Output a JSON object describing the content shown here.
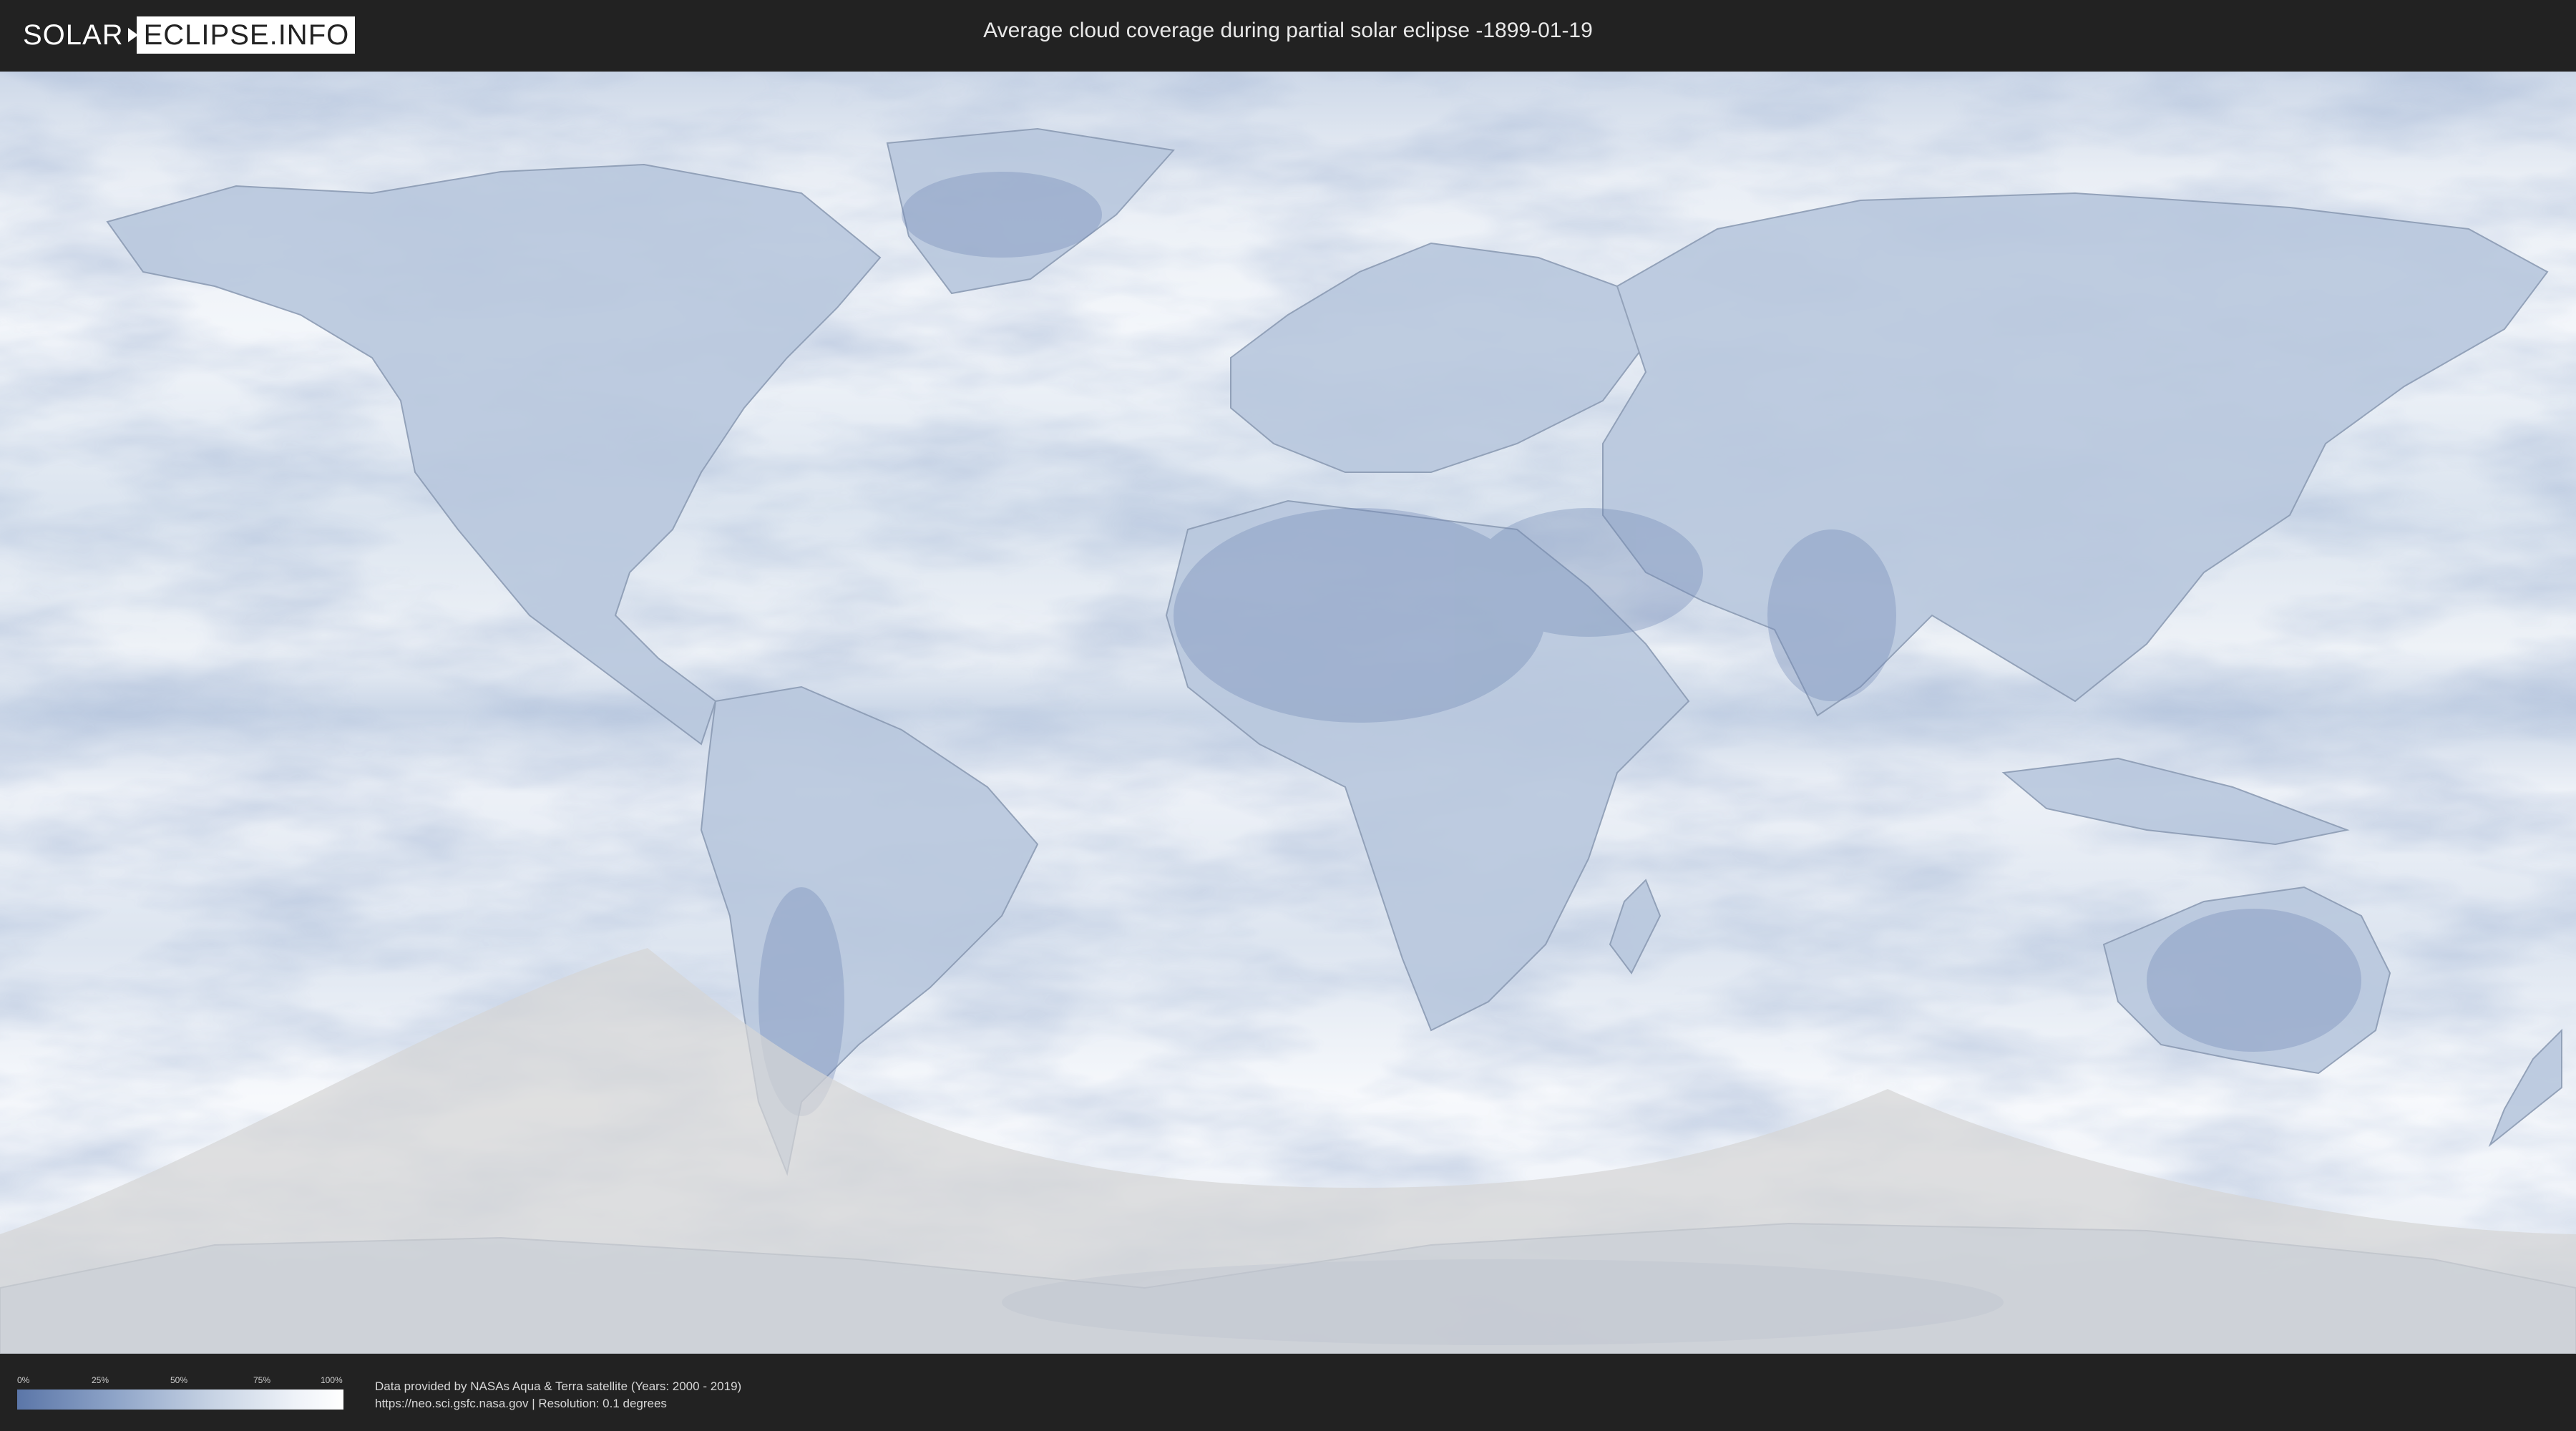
{
  "header": {
    "logo_left": "SOLAR",
    "logo_right": "ECLIPSE.INFO",
    "title": "Average cloud coverage during partial solar eclipse -1899-01-19"
  },
  "legend": {
    "ticks": [
      "0%",
      "25%",
      "50%",
      "75%",
      "100%"
    ],
    "scale": {
      "min_color": "#5b76a8",
      "max_color": "#ffffff"
    }
  },
  "credits": {
    "line1": "Data provided by NASAs Aqua & Terra satellite (Years: 2000 - 2019)",
    "line2": "https://neo.sci.gsfc.nasa.gov | Resolution: 0.1 degrees"
  },
  "colors": {
    "background": "#222222",
    "cloud_low": "#5b76a8",
    "cloud_high": "#ffffff",
    "eclipse_shading": "#d0d0d0"
  }
}
